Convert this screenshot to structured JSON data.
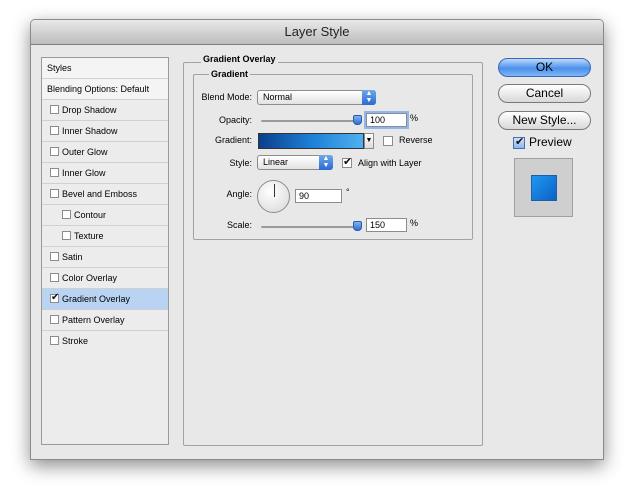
{
  "window": {
    "title": "Layer Style"
  },
  "style_list": {
    "header": "Styles",
    "blending_options": "Blending Options: Default",
    "items": [
      {
        "label": "Drop Shadow",
        "checked": false,
        "indent": false
      },
      {
        "label": "Inner Shadow",
        "checked": false,
        "indent": false
      },
      {
        "label": "Outer Glow",
        "checked": false,
        "indent": false
      },
      {
        "label": "Inner Glow",
        "checked": false,
        "indent": false
      },
      {
        "label": "Bevel and Emboss",
        "checked": false,
        "indent": false
      },
      {
        "label": "Contour",
        "checked": false,
        "indent": true
      },
      {
        "label": "Texture",
        "checked": false,
        "indent": true
      },
      {
        "label": "Satin",
        "checked": false,
        "indent": false
      },
      {
        "label": "Color Overlay",
        "checked": false,
        "indent": false
      },
      {
        "label": "Gradient Overlay",
        "checked": true,
        "indent": false,
        "selected": true
      },
      {
        "label": "Pattern Overlay",
        "checked": false,
        "indent": false
      },
      {
        "label": "Stroke",
        "checked": false,
        "indent": false
      }
    ]
  },
  "panel": {
    "title": "Gradient Overlay",
    "group_title": "Gradient",
    "blend_mode": {
      "label": "Blend Mode:",
      "value": "Normal"
    },
    "opacity": {
      "label": "Opacity:",
      "value": "100",
      "unit": "%",
      "level": 1.0
    },
    "gradient": {
      "label": "Gradient:",
      "colors": [
        "#0b3f8a",
        "#1d7fd6",
        "#4fb0f0"
      ]
    },
    "reverse": {
      "label": "Reverse",
      "checked": false
    },
    "style": {
      "label": "Style:",
      "value": "Linear"
    },
    "align_with_layer": {
      "label": "Align with Layer",
      "checked": true
    },
    "angle": {
      "label": "Angle:",
      "value": "90",
      "unit": "°"
    },
    "scale": {
      "label": "Scale:",
      "value": "150",
      "unit": "%",
      "level": 1.0
    }
  },
  "buttons": {
    "ok": "OK",
    "cancel": "Cancel",
    "new_style": "New Style..."
  },
  "preview": {
    "label": "Preview",
    "checked": true,
    "swatch_color": "#1a7fe0"
  },
  "icons": {
    "dropdown": "chevron-updown-icon",
    "check": "checkmark-icon"
  },
  "colors": {
    "selection": "#b9d4f3",
    "accent": "#3f86e6"
  }
}
